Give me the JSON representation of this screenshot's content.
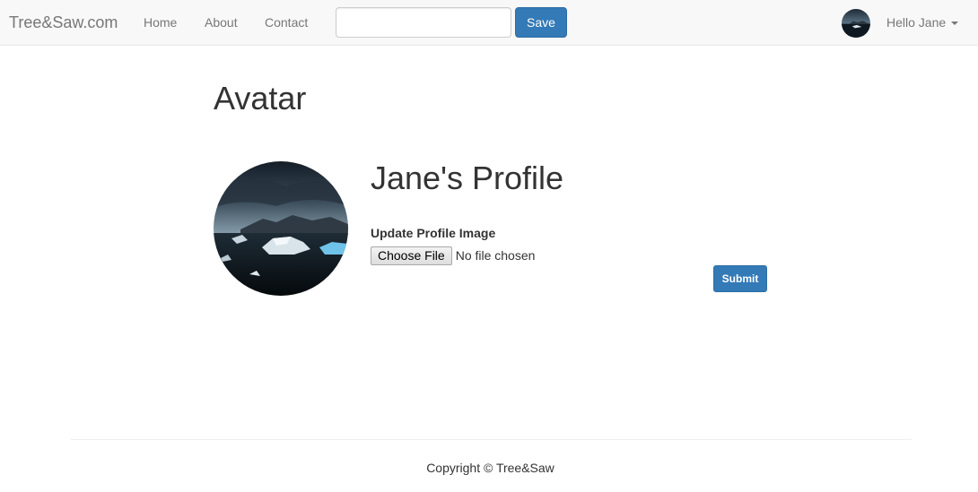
{
  "navbar": {
    "brand": "Tree&Saw.com",
    "links": [
      "Home",
      "About",
      "Contact"
    ],
    "search": {
      "value": "",
      "placeholder": ""
    },
    "save_label": "Save",
    "user_greeting": "Hello Jane",
    "avatar_icon": "user-avatar-photo"
  },
  "main": {
    "heading": "Avatar",
    "profile_title": "Jane's Profile",
    "profile_image_icon": "profile-photo-icebergs",
    "upload": {
      "label": "Update Profile Image",
      "choose_file_label": "Choose File",
      "file_status": "No file chosen"
    },
    "submit_label": "Submit"
  },
  "footer": {
    "copyright": "Copyright © Tree&Saw"
  },
  "colors": {
    "primary": "#337ab7",
    "navbar_bg": "#f8f8f8",
    "nav_text": "#777777",
    "body_text": "#333333"
  }
}
